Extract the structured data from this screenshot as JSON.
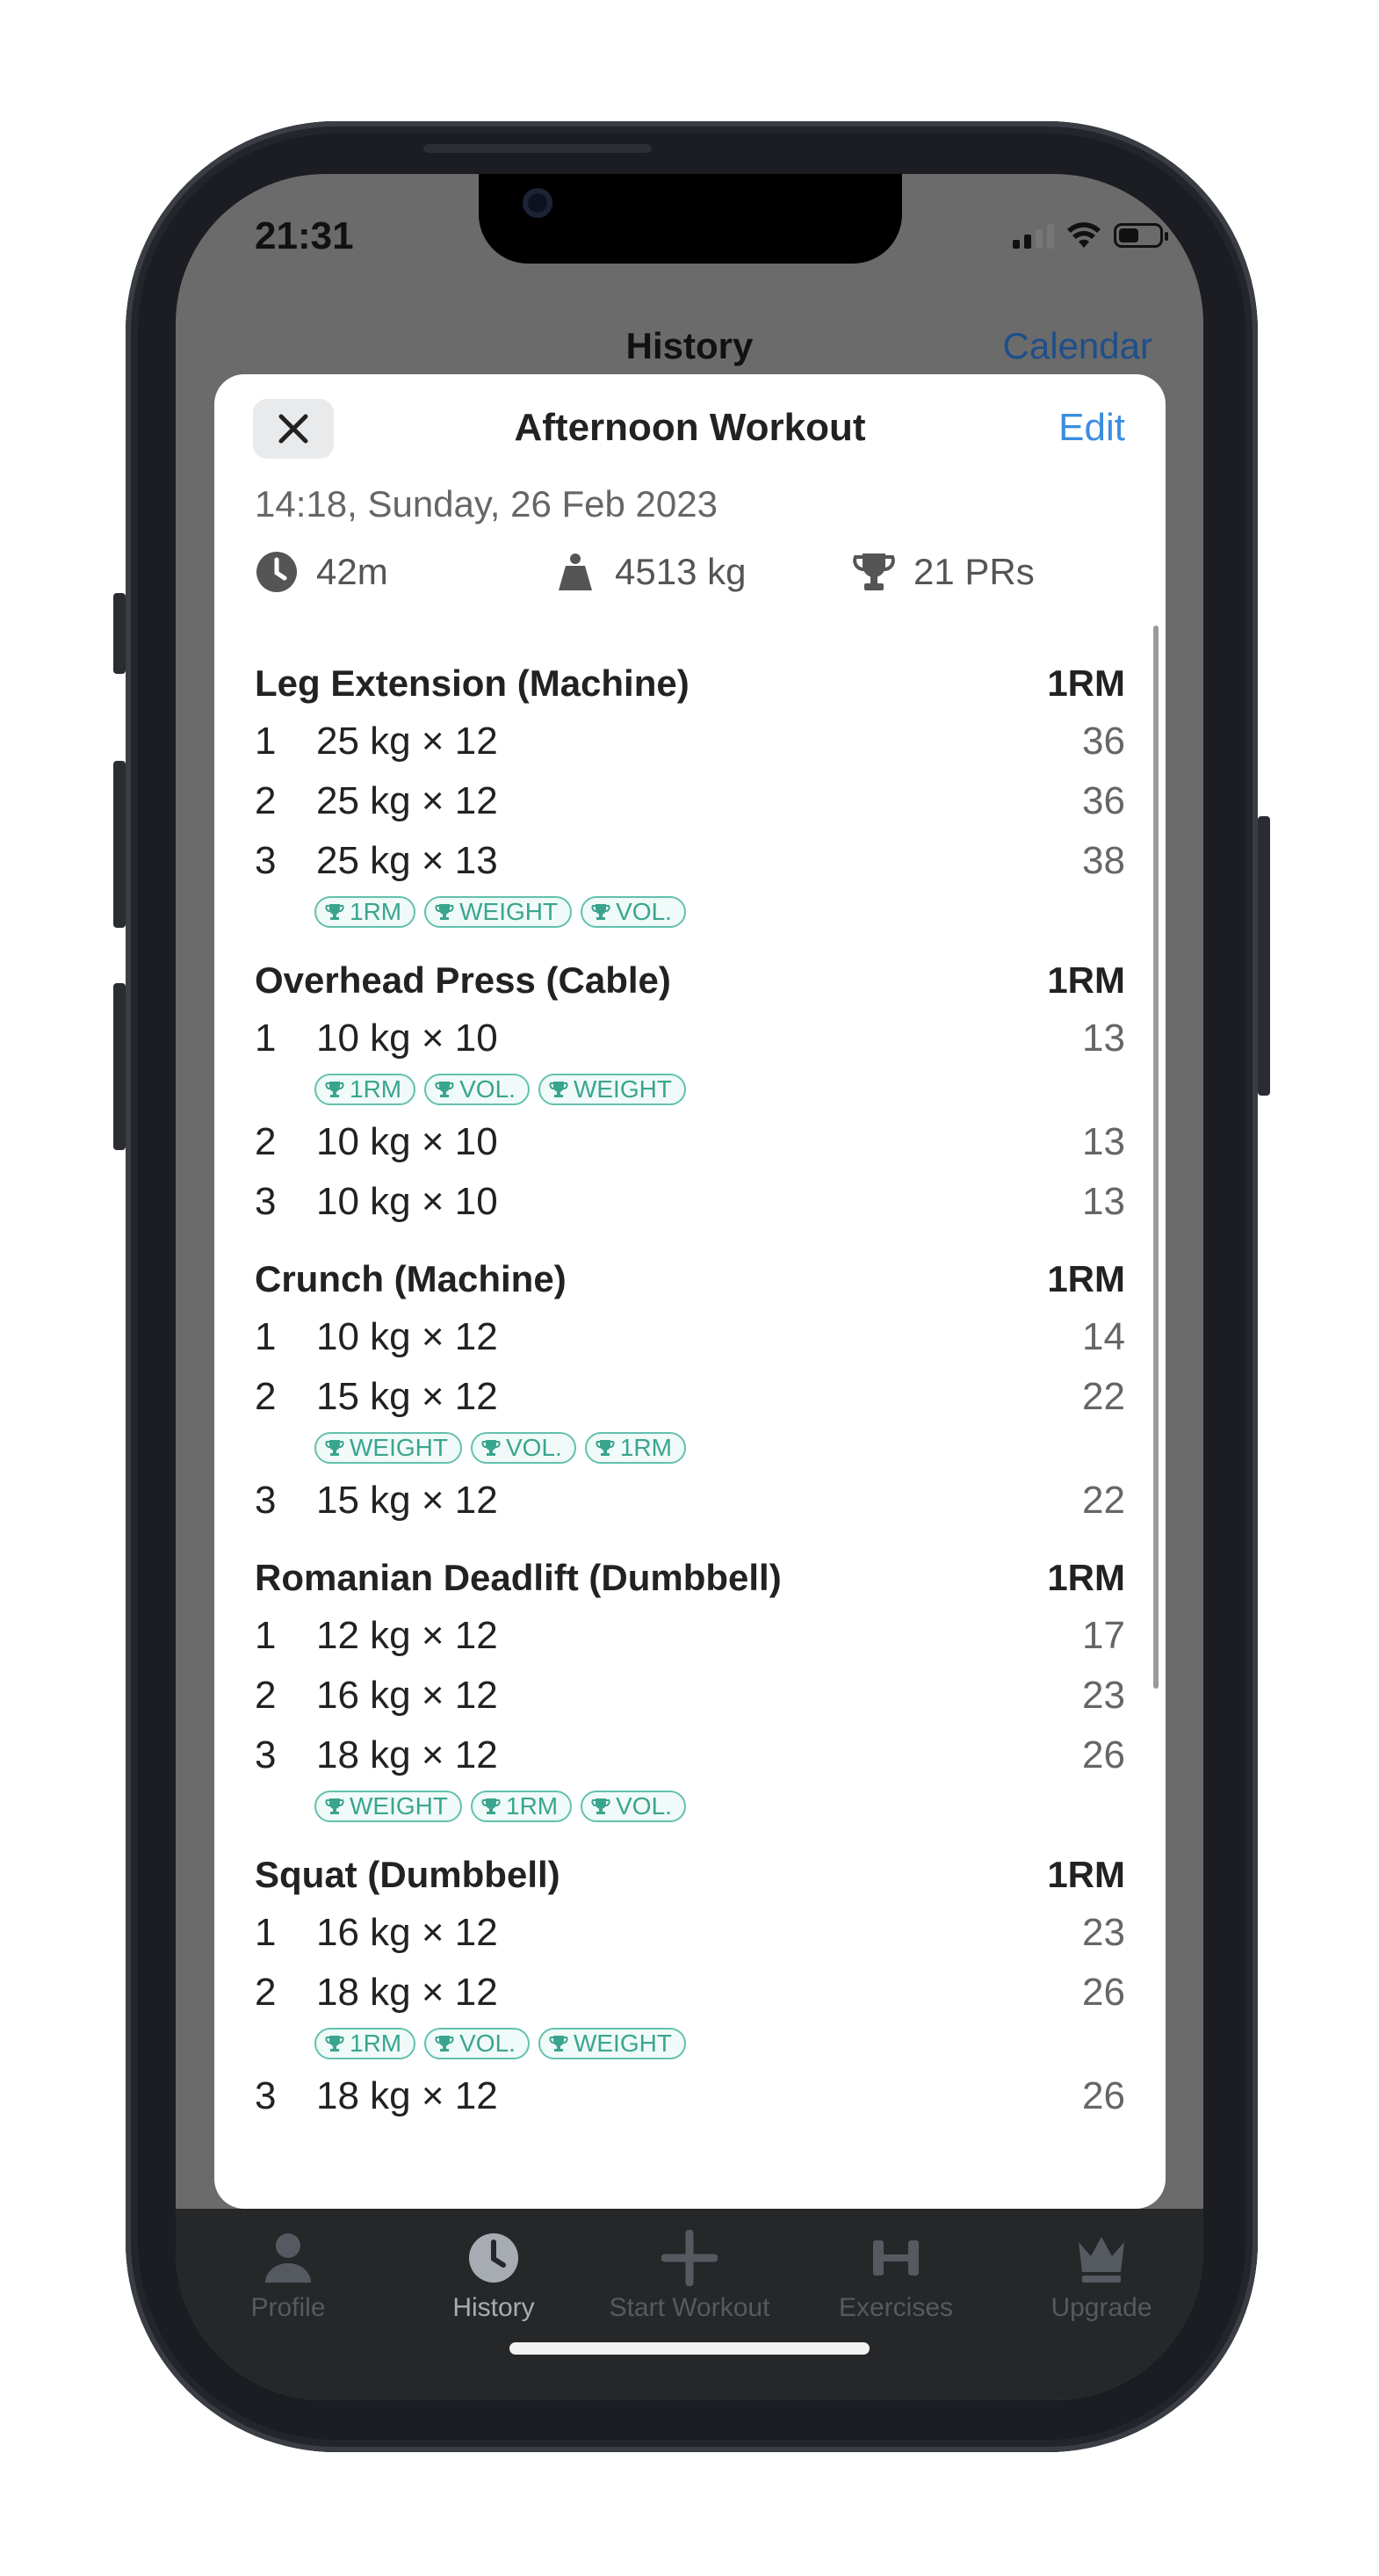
{
  "status_bar": {
    "time": "21:31"
  },
  "background_header": {
    "title": "History",
    "action": "Calendar"
  },
  "sheet": {
    "close_icon": "close-icon",
    "title": "Afternoon Workout",
    "edit_label": "Edit",
    "date": "14:18, Sunday, 26 Feb 2023",
    "stats": {
      "duration": "42m",
      "volume": "4513 kg",
      "prs": "21 PRs"
    },
    "exercises": [
      {
        "name": "Leg Extension (Machine)",
        "metric": "1RM",
        "sets": [
          {
            "idx": "1",
            "value": "25 kg × 12",
            "orm": "36"
          },
          {
            "idx": "2",
            "value": "25 kg × 12",
            "orm": "36"
          },
          {
            "idx": "3",
            "value": "25 kg × 13",
            "orm": "38",
            "badges": [
              "1RM",
              "WEIGHT",
              "VOL."
            ]
          }
        ]
      },
      {
        "name": "Overhead Press (Cable)",
        "metric": "1RM",
        "sets": [
          {
            "idx": "1",
            "value": "10 kg × 10",
            "orm": "13",
            "badges": [
              "1RM",
              "VOL.",
              "WEIGHT"
            ]
          },
          {
            "idx": "2",
            "value": "10 kg × 10",
            "orm": "13"
          },
          {
            "idx": "3",
            "value": "10 kg × 10",
            "orm": "13"
          }
        ]
      },
      {
        "name": "Crunch (Machine)",
        "metric": "1RM",
        "sets": [
          {
            "idx": "1",
            "value": "10 kg × 12",
            "orm": "14"
          },
          {
            "idx": "2",
            "value": "15 kg × 12",
            "orm": "22",
            "badges": [
              "WEIGHT",
              "VOL.",
              "1RM"
            ]
          },
          {
            "idx": "3",
            "value": "15 kg × 12",
            "orm": "22"
          }
        ]
      },
      {
        "name": "Romanian Deadlift (Dumbbell)",
        "metric": "1RM",
        "sets": [
          {
            "idx": "1",
            "value": "12 kg × 12",
            "orm": "17"
          },
          {
            "idx": "2",
            "value": "16 kg × 12",
            "orm": "23"
          },
          {
            "idx": "3",
            "value": "18 kg × 12",
            "orm": "26",
            "badges": [
              "WEIGHT",
              "1RM",
              "VOL."
            ]
          }
        ]
      },
      {
        "name": "Squat (Dumbbell)",
        "metric": "1RM",
        "sets": [
          {
            "idx": "1",
            "value": "16 kg × 12",
            "orm": "23"
          },
          {
            "idx": "2",
            "value": "18 kg × 12",
            "orm": "26",
            "badges": [
              "1RM",
              "VOL.",
              "WEIGHT"
            ]
          },
          {
            "idx": "3",
            "value": "18 kg × 12",
            "orm": "26"
          }
        ]
      }
    ]
  },
  "tabbar": {
    "items": [
      {
        "label": "Profile",
        "icon": "person-icon",
        "active": false
      },
      {
        "label": "History",
        "icon": "clock-icon",
        "active": true
      },
      {
        "label": "Start Workout",
        "icon": "plus-icon",
        "active": false
      },
      {
        "label": "Exercises",
        "icon": "dumbbell-icon",
        "active": false
      },
      {
        "label": "Upgrade",
        "icon": "crown-icon",
        "active": false
      }
    ]
  },
  "colors": {
    "accent": "#3a8ee0",
    "badge": "#62c1ad",
    "tabbar_bg": "#262729"
  }
}
